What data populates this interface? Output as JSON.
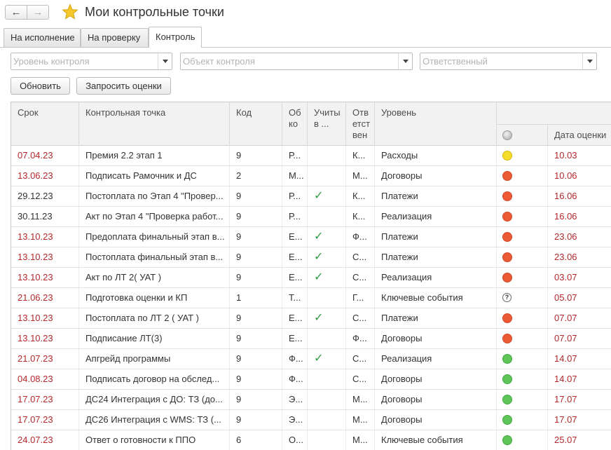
{
  "window": {
    "title": "Мои контрольные точки"
  },
  "tabs": [
    "На исполнение",
    "На проверку",
    "Контроль"
  ],
  "filters": {
    "level_placeholder": "Уровень контроля",
    "object_placeholder": "Объект контроля",
    "responsible_placeholder": "Ответственный"
  },
  "toolbar": {
    "refresh": "Обновить",
    "request": "Запросить оценки"
  },
  "columns": {
    "deadline": "Срок",
    "checkpoint": "Контрольная точка",
    "code": "Код",
    "object": "Об\nко",
    "accounted": "Учиты\nв ...",
    "responsible": "Отв\nетст\nвен",
    "level": "Уровень",
    "rating_date": "Дата оценки"
  },
  "rows": [
    {
      "deadline": "07.04.23",
      "overdue": true,
      "name": "Премия 2.2 этап 1",
      "code": "9",
      "object": "Р...",
      "check": false,
      "resp": "К...",
      "level": "Расходы",
      "status": "yellow",
      "rating_date": "10.03"
    },
    {
      "deadline": "13.06.23",
      "overdue": true,
      "name": "Подписать Рамочник и ДС",
      "code": "2",
      "object": "М...",
      "check": false,
      "resp": "М...",
      "level": "Договоры",
      "status": "red",
      "rating_date": "10.06"
    },
    {
      "deadline": "29.12.23",
      "overdue": false,
      "name": "Постоплата по Этап 4 \"Провер...",
      "code": "9",
      "object": "Р...",
      "check": true,
      "resp": "К...",
      "level": "Платежи",
      "status": "red",
      "rating_date": "16.06"
    },
    {
      "deadline": "30.11.23",
      "overdue": false,
      "name": "Акт по Этап 4 \"Проверка работ...",
      "code": "9",
      "object": "Р...",
      "check": false,
      "resp": "К...",
      "level": "Реализация",
      "status": "red",
      "rating_date": "16.06"
    },
    {
      "deadline": "13.10.23",
      "overdue": true,
      "name": "Предоплата финальный этап в...",
      "code": "9",
      "object": "Е...",
      "check": true,
      "resp": "Ф...",
      "level": "Платежи",
      "status": "red",
      "rating_date": "23.06"
    },
    {
      "deadline": "13.10.23",
      "overdue": true,
      "name": "Постоплата финальный этап в...",
      "code": "9",
      "object": "Е...",
      "check": true,
      "resp": "С...",
      "level": "Платежи",
      "status": "red",
      "rating_date": "23.06"
    },
    {
      "deadline": "13.10.23",
      "overdue": true,
      "name": "Акт по ЛТ 2( УАТ )",
      "code": "9",
      "object": "Е...",
      "check": true,
      "resp": "С...",
      "level": "Реализация",
      "status": "red",
      "rating_date": "03.07"
    },
    {
      "deadline": "21.06.23",
      "overdue": true,
      "name": "Подготовка оценки и КП",
      "code": "1",
      "object": "Т...",
      "check": false,
      "resp": "Г...",
      "level": "Ключевые события",
      "status": "question",
      "rating_date": "05.07"
    },
    {
      "deadline": "13.10.23",
      "overdue": true,
      "name": "Постоплата по ЛТ 2 ( УАТ )",
      "code": "9",
      "object": "Е...",
      "check": true,
      "resp": "С...",
      "level": "Платежи",
      "status": "red",
      "rating_date": "07.07"
    },
    {
      "deadline": "13.10.23",
      "overdue": true,
      "name": "Подписание  ЛТ(3)",
      "code": "9",
      "object": "Е...",
      "check": false,
      "resp": "Ф...",
      "level": "Договоры",
      "status": "red",
      "rating_date": "07.07"
    },
    {
      "deadline": "21.07.23",
      "overdue": true,
      "name": "Апгрейд программы",
      "code": "9",
      "object": "Ф...",
      "check": true,
      "resp": "С...",
      "level": "Реализация",
      "status": "green",
      "rating_date": "14.07"
    },
    {
      "deadline": "04.08.23",
      "overdue": true,
      "name": "Подписать договор на обслед...",
      "code": "9",
      "object": "Ф...",
      "check": false,
      "resp": "С...",
      "level": "Договоры",
      "status": "green",
      "rating_date": "14.07"
    },
    {
      "deadline": "17.07.23",
      "overdue": true,
      "name": "ДС24 Интеграция с ДО: ТЗ (до...",
      "code": "9",
      "object": "Э...",
      "check": false,
      "resp": "М...",
      "level": "Договоры",
      "status": "green",
      "rating_date": "17.07"
    },
    {
      "deadline": "17.07.23",
      "overdue": true,
      "name": "ДС26 Интеграция с WMS: ТЗ (...",
      "code": "9",
      "object": "Э...",
      "check": false,
      "resp": "М...",
      "level": "Договоры",
      "status": "green",
      "rating_date": "17.07"
    },
    {
      "deadline": "24.07.23",
      "overdue": true,
      "name": "Ответ о готовности к ППО",
      "code": "6",
      "object": "О...",
      "check": false,
      "resp": "М...",
      "level": "Ключевые события",
      "status": "green",
      "rating_date": "25.07"
    }
  ],
  "colors": {
    "overdue_text": "#b5282c",
    "check": "#2e9a46",
    "status_red": "#ec5a35",
    "status_yellow": "#f5dd2a",
    "status_green": "#5fc45a"
  },
  "icons": {
    "back": "arrow-left-icon",
    "forward": "arrow-right-icon",
    "favorite": "star-icon"
  }
}
